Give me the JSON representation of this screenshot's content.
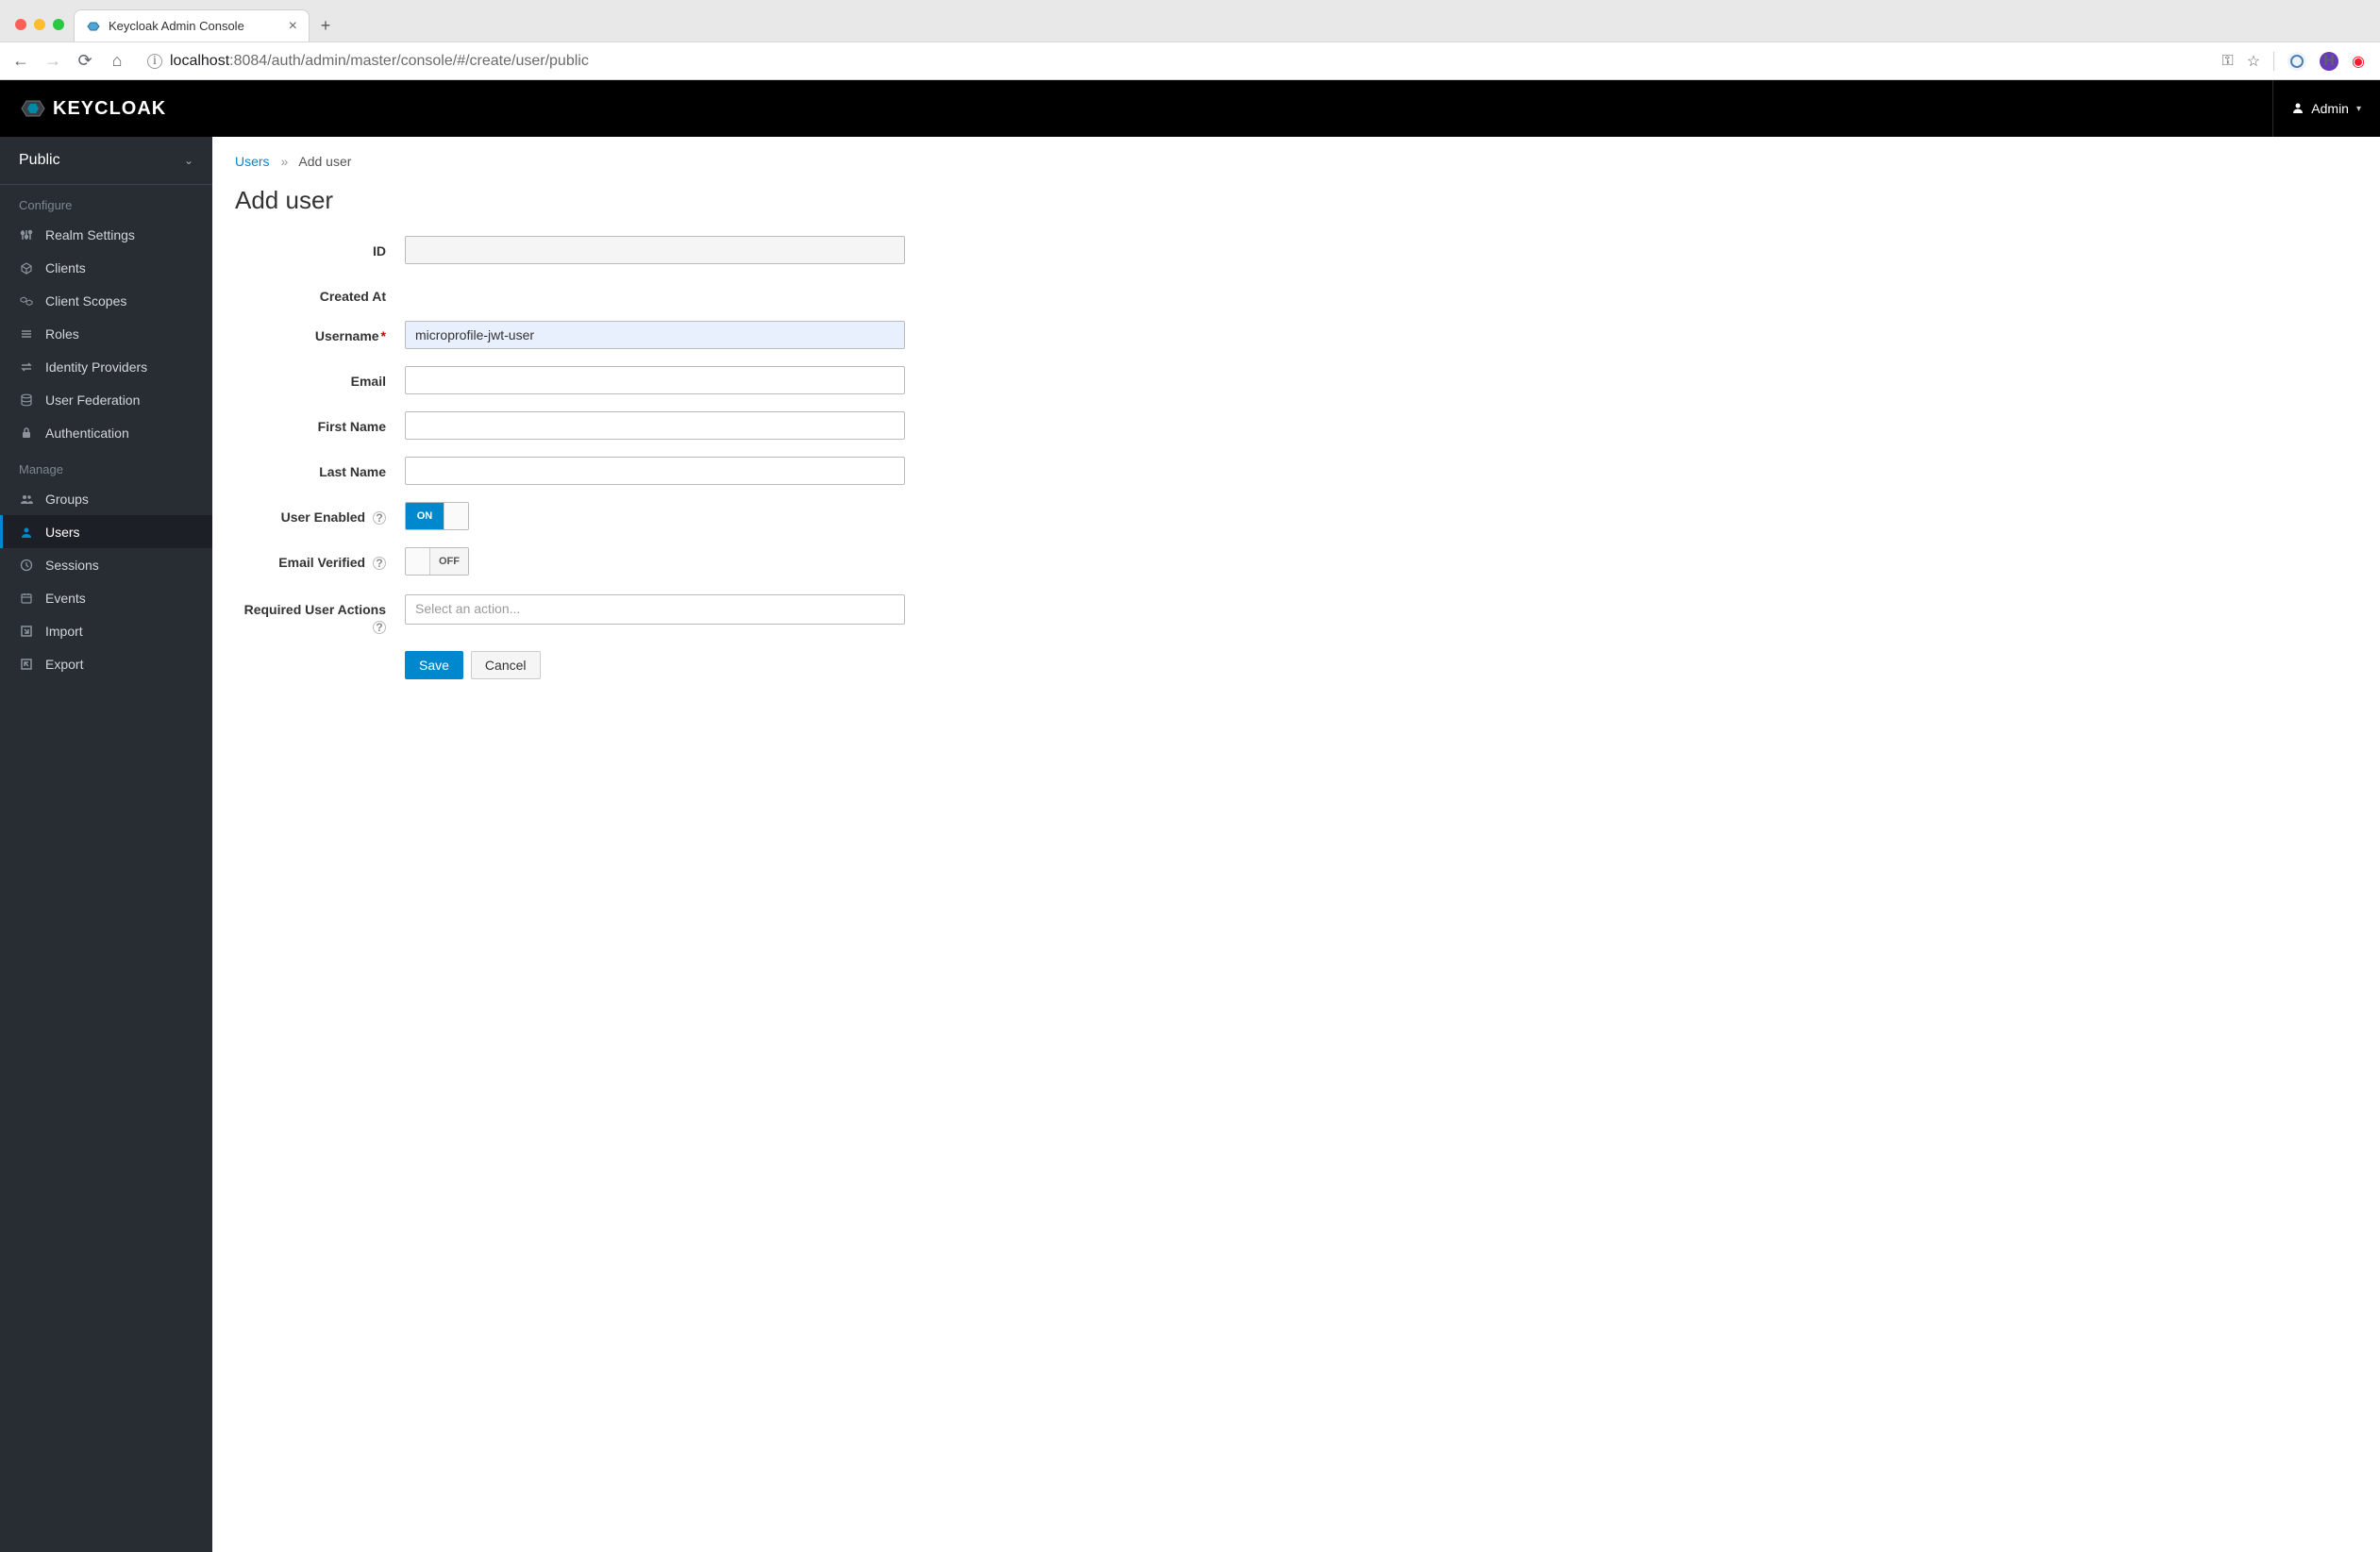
{
  "browser": {
    "tab_title": "Keycloak Admin Console",
    "url_host": "localhost",
    "url_path": ":8084/auth/admin/master/console/#/create/user/public"
  },
  "header": {
    "brand": "KEYCLOAK",
    "user_label": "Admin"
  },
  "sidebar": {
    "realm": "Public",
    "section_configure": "Configure",
    "section_manage": "Manage",
    "items_configure": [
      {
        "label": "Realm Settings"
      },
      {
        "label": "Clients"
      },
      {
        "label": "Client Scopes"
      },
      {
        "label": "Roles"
      },
      {
        "label": "Identity Providers"
      },
      {
        "label": "User Federation"
      },
      {
        "label": "Authentication"
      }
    ],
    "items_manage": [
      {
        "label": "Groups"
      },
      {
        "label": "Users"
      },
      {
        "label": "Sessions"
      },
      {
        "label": "Events"
      },
      {
        "label": "Import"
      },
      {
        "label": "Export"
      }
    ]
  },
  "breadcrumb": {
    "parent": "Users",
    "current": "Add user"
  },
  "page": {
    "title": "Add user"
  },
  "form": {
    "labels": {
      "id": "ID",
      "created_at": "Created At",
      "username": "Username",
      "email": "Email",
      "first_name": "First Name",
      "last_name": "Last Name",
      "user_enabled": "User Enabled",
      "email_verified": "Email Verified",
      "required_actions": "Required User Actions"
    },
    "values": {
      "id": "",
      "created_at": "",
      "username": "microprofile-jwt-user",
      "email": "",
      "first_name": "",
      "last_name": ""
    },
    "placeholders": {
      "required_actions": "Select an action..."
    },
    "toggles": {
      "user_enabled_on": "ON",
      "email_verified_off": "OFF"
    },
    "buttons": {
      "save": "Save",
      "cancel": "Cancel"
    }
  }
}
